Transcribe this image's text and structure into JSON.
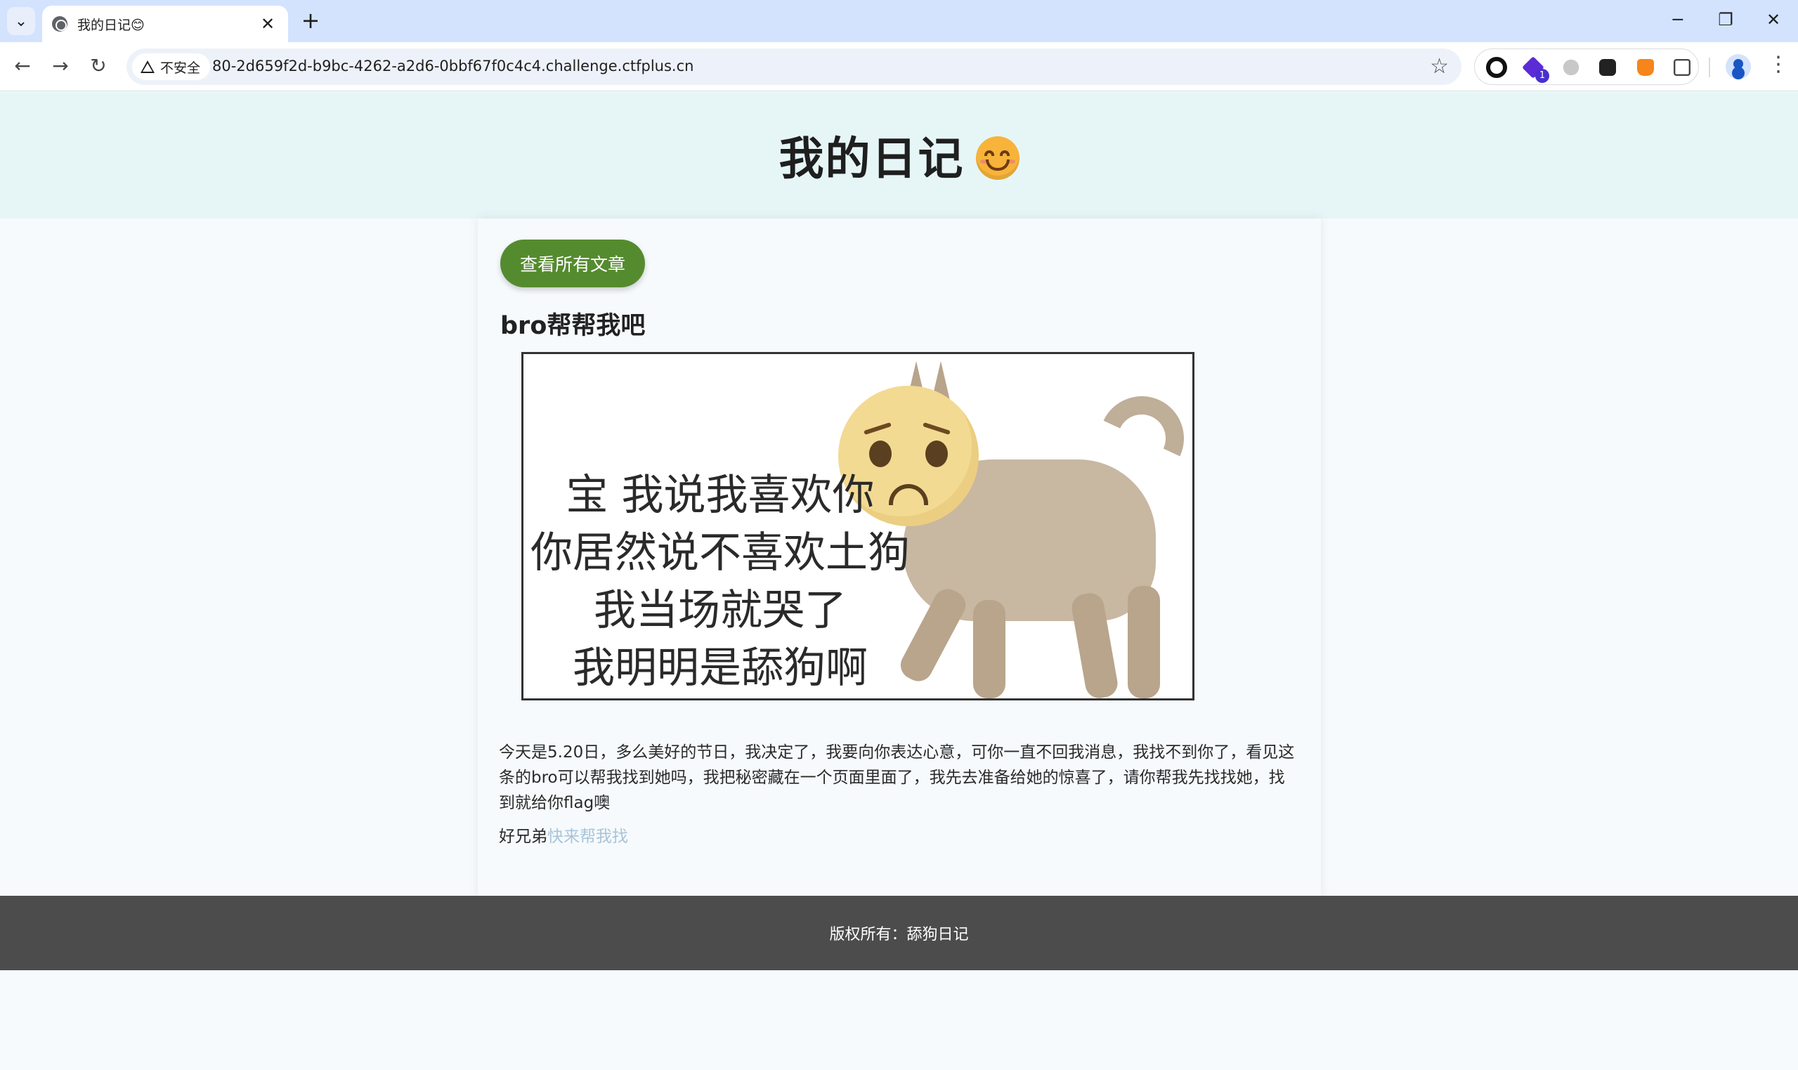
{
  "browser": {
    "tab_title": "我的日记😊",
    "security_label": "不安全",
    "url": "80-2d659f2d-b9bc-4262-a2d6-0bbf67f0c4c4.challenge.ctfplus.cn",
    "extension_badge": "1",
    "controls": {
      "new_tab": "+",
      "close_tab": "✕",
      "back": "←",
      "forward": "→",
      "reload": "↻",
      "star": "☆",
      "minimize": "─",
      "restore": "❐",
      "close": "✕",
      "menu": "⋮",
      "tab_search": "⌄"
    }
  },
  "site": {
    "title": "我的日记",
    "title_emoji": "smiling-face-icon"
  },
  "article": {
    "view_all_button": "查看所有文章",
    "title": "bro帮帮我吧",
    "image_caption_lines": [
      "宝 我说我喜欢你",
      "你居然说不喜欢土狗",
      "我当场就哭了",
      "我明明是舔狗啊"
    ],
    "body": "今天是5.20日，多么美好的节日，我决定了，我要向你表达心意，可你一直不回我消息，我找不到你了，看见这条的bro可以帮我找到她吗，我把秘密藏在一个页面里面了，我先去准备给她的惊喜了，请你帮我先找找她，找到就给你flag噢",
    "footer_prefix": "好兄弟",
    "footer_link": "快来帮我找"
  },
  "footer": {
    "copyright": "版权所有：舔狗日记"
  }
}
